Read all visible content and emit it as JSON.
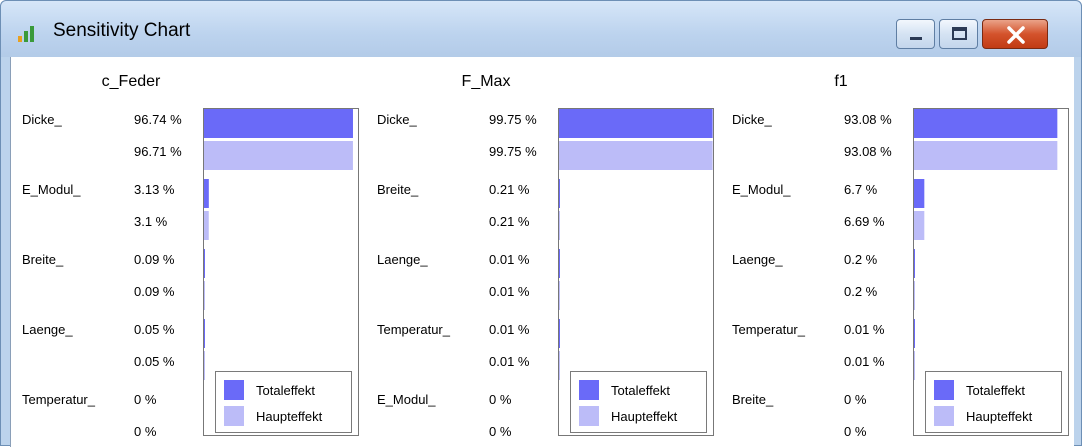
{
  "window": {
    "title": "Sensitivity Chart",
    "icons": {
      "app": "bar-chart-icon",
      "minimize": "minimize-icon",
      "maximize": "maximize-icon",
      "close": "close-icon"
    }
  },
  "colors": {
    "totaleffekt": "#6a6af8",
    "haupteffekt": "#bcbcf8"
  },
  "legend": {
    "total_label": "Totaleffekt",
    "main_label": "Haupteffekt"
  },
  "chart_data": [
    {
      "type": "bar",
      "title": "c_Feder",
      "categories": [
        "Dicke_",
        "E_Modul_",
        "Breite_",
        "Laenge_",
        "Temperatur_"
      ],
      "series": [
        {
          "name": "Totaleffekt",
          "values": [
            96.74,
            3.13,
            0.09,
            0.05,
            0
          ],
          "labels": [
            "96.74 %",
            "3.13 %",
            "0.09 %",
            "0.05 %",
            "0 %"
          ]
        },
        {
          "name": "Haupteffekt",
          "values": [
            96.71,
            3.1,
            0.09,
            0.05,
            0
          ],
          "labels": [
            "96.71 %",
            "3.1 %",
            "0.09 %",
            "0.05 %",
            "0 %"
          ]
        }
      ],
      "xlim": [
        0,
        100
      ]
    },
    {
      "type": "bar",
      "title": "F_Max",
      "categories": [
        "Dicke_",
        "Breite_",
        "Laenge_",
        "Temperatur_",
        "E_Modul_"
      ],
      "series": [
        {
          "name": "Totaleffekt",
          "values": [
            99.75,
            0.21,
            0.01,
            0.01,
            0
          ],
          "labels": [
            "99.75 %",
            "0.21 %",
            "0.01 %",
            "0.01 %",
            "0 %"
          ]
        },
        {
          "name": "Haupteffekt",
          "values": [
            99.75,
            0.21,
            0.01,
            0.01,
            0
          ],
          "labels": [
            "99.75 %",
            "0.21 %",
            "0.01 %",
            "0.01 %",
            "0 %"
          ]
        }
      ],
      "xlim": [
        0,
        100
      ]
    },
    {
      "type": "bar",
      "title": "f1",
      "categories": [
        "Dicke_",
        "E_Modul_",
        "Laenge_",
        "Temperatur_",
        "Breite_"
      ],
      "series": [
        {
          "name": "Totaleffekt",
          "values": [
            93.08,
            6.7,
            0.2,
            0.01,
            0
          ],
          "labels": [
            "93.08 %",
            "6.7 %",
            "0.2 %",
            "0.01 %",
            "0 %"
          ]
        },
        {
          "name": "Haupteffekt",
          "values": [
            93.08,
            6.69,
            0.2,
            0.01,
            0
          ],
          "labels": [
            "93.08 %",
            "6.69 %",
            "0.2 %",
            "0.01 %",
            "0 %"
          ]
        }
      ],
      "xlim": [
        0,
        100
      ]
    }
  ]
}
